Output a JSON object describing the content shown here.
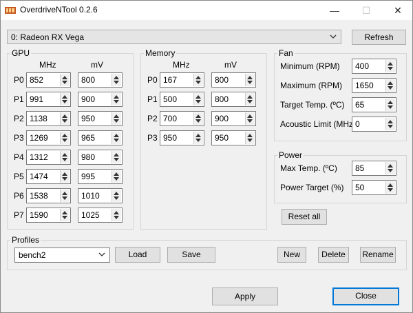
{
  "window": {
    "title": "OverdriveNTool 0.2.6",
    "controls": {
      "minimize": "—",
      "maximize": "☐",
      "close": "✕"
    }
  },
  "device": {
    "selected": "0: Radeon RX Vega",
    "refresh_label": "Refresh"
  },
  "gpu": {
    "group_label": "GPU",
    "col_mhz": "MHz",
    "col_mv": "mV",
    "rows": [
      {
        "label": "P0",
        "mhz": "852",
        "mv": "800"
      },
      {
        "label": "P1",
        "mhz": "991",
        "mv": "900"
      },
      {
        "label": "P2",
        "mhz": "1138",
        "mv": "950"
      },
      {
        "label": "P3",
        "mhz": "1269",
        "mv": "965"
      },
      {
        "label": "P4",
        "mhz": "1312",
        "mv": "980"
      },
      {
        "label": "P5",
        "mhz": "1474",
        "mv": "995"
      },
      {
        "label": "P6",
        "mhz": "1538",
        "mv": "1010"
      },
      {
        "label": "P7",
        "mhz": "1590",
        "mv": "1025"
      }
    ]
  },
  "memory": {
    "group_label": "Memory",
    "col_mhz": "MHz",
    "col_mv": "mV",
    "rows": [
      {
        "label": "P0",
        "mhz": "167",
        "mv": "800"
      },
      {
        "label": "P1",
        "mhz": "500",
        "mv": "800"
      },
      {
        "label": "P2",
        "mhz": "700",
        "mv": "900"
      },
      {
        "label": "P3",
        "mhz": "950",
        "mv": "950"
      }
    ]
  },
  "fan": {
    "group_label": "Fan",
    "rows": [
      {
        "label": "Minimum (RPM)",
        "value": "400"
      },
      {
        "label": "Maximum (RPM)",
        "value": "1650"
      },
      {
        "label": "Target Temp. (ºC)",
        "value": "65"
      },
      {
        "label": "Acoustic Limit (MHz)",
        "value": "0"
      }
    ]
  },
  "power": {
    "group_label": "Power",
    "rows": [
      {
        "label": "Max Temp. (ºC)",
        "value": "85"
      },
      {
        "label": "Power Target (%)",
        "value": "50"
      }
    ]
  },
  "reset_label": "Reset all",
  "profiles": {
    "group_label": "Profiles",
    "selected": "bench2",
    "load_label": "Load",
    "save_label": "Save",
    "new_label": "New",
    "delete_label": "Delete",
    "rename_label": "Rename"
  },
  "footer": {
    "apply_label": "Apply",
    "close_label": "Close"
  },
  "colors": {
    "accent": "#0078d7",
    "icon": "#c8561e"
  }
}
